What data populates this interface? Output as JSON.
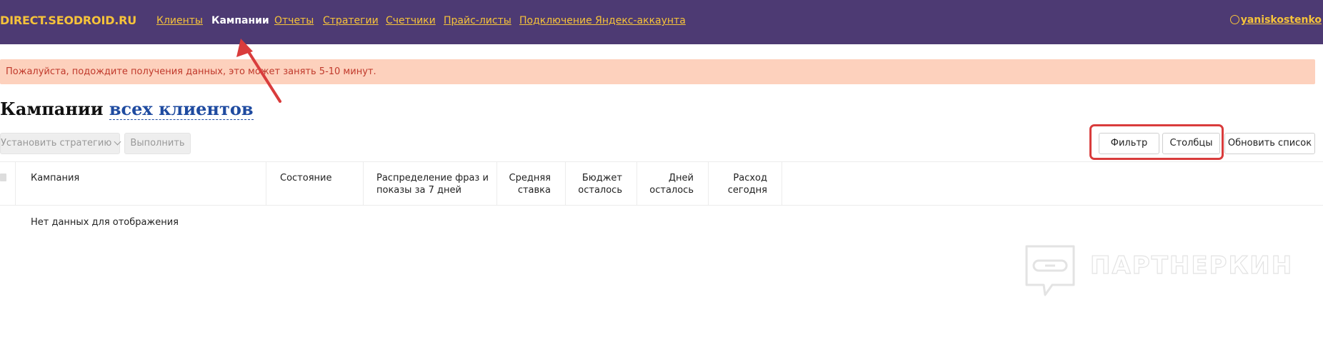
{
  "header": {
    "logo": "DIRECT.SEODROID.RU",
    "nav": [
      {
        "label": "Клиенты",
        "active": false
      },
      {
        "label": "Кампании",
        "active": true
      },
      {
        "label": "Отчеты",
        "active": false
      },
      {
        "label": "Стратегии",
        "active": false
      },
      {
        "label": "Счетчики",
        "active": false
      },
      {
        "label": "Прайс-листы",
        "active": false
      },
      {
        "label": "Подключение Яндекс-аккаунта",
        "active": false
      }
    ],
    "user": "yaniskostenko"
  },
  "alert": {
    "text": "Пожалуйста, подождите получения данных, это может занять 5-10 минут."
  },
  "page": {
    "title": "Кампании",
    "scope": "всех клиентов"
  },
  "toolbar": {
    "strategy": "Установить стратегию",
    "execute": "Выполнить",
    "filter": "Фильтр",
    "columns": "Столбцы",
    "refresh": "Обновить список"
  },
  "table": {
    "columns": [
      "Кампания",
      "Состояние",
      "Распределение фраз и показы за 7 дней",
      "Средняя ставка",
      "Бюджет осталось",
      "Дней осталось",
      "Расход сегодня"
    ],
    "empty": "Нет данных для отображения"
  },
  "watermark": {
    "text": "ПАРТНЕРКИН",
    "icon": "robot-chat-icon"
  },
  "colors": {
    "header_bg": "#4d3a73",
    "nav_link": "#f6c33a",
    "alert_bg": "#fdd1bd",
    "alert_text": "#c0392b",
    "title_scope": "#1f4ba0",
    "annotation": "#d93c3c"
  }
}
